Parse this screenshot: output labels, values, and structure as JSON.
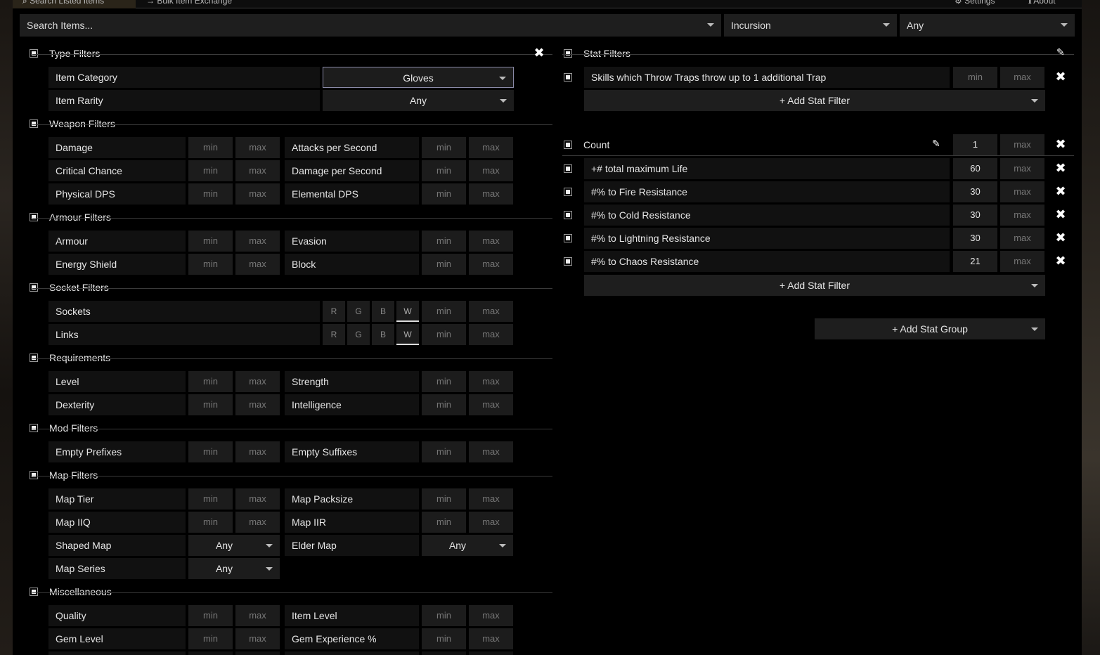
{
  "tabs": {
    "search": "Search Listed Items",
    "bulk": "Bulk Item Exchange",
    "settings": "Settings",
    "about": "About"
  },
  "search": {
    "placeholder": "Search Items...",
    "league": "Incursion",
    "status": "Any"
  },
  "type_filters": {
    "title": "Type Filters",
    "category_label": "Item Category",
    "category_value": "Gloves",
    "rarity_label": "Item Rarity",
    "rarity_value": "Any"
  },
  "weapon_filters": {
    "title": "Weapon Filters",
    "rows": [
      [
        "Damage",
        "Attacks per Second"
      ],
      [
        "Critical Chance",
        "Damage per Second"
      ],
      [
        "Physical DPS",
        "Elemental DPS"
      ]
    ]
  },
  "armour_filters": {
    "title": "Armour Filters",
    "rows": [
      [
        "Armour",
        "Evasion"
      ],
      [
        "Energy Shield",
        "Block"
      ]
    ]
  },
  "socket_filters": {
    "title": "Socket Filters",
    "sockets": "Sockets",
    "links": "Links",
    "colors": [
      "R",
      "G",
      "B",
      "W"
    ]
  },
  "requirements": {
    "title": "Requirements",
    "rows": [
      [
        "Level",
        "Strength"
      ],
      [
        "Dexterity",
        "Intelligence"
      ]
    ]
  },
  "mod_filters": {
    "title": "Mod Filters",
    "rows": [
      [
        "Empty Prefixes",
        "Empty Suffixes"
      ]
    ]
  },
  "map_filters": {
    "title": "Map Filters",
    "rows": [
      [
        "Map Tier",
        "Map Packsize"
      ],
      [
        "Map IIQ",
        "Map IIR"
      ]
    ],
    "shaped": "Shaped Map",
    "elder": "Elder Map",
    "series": "Map Series",
    "any": "Any"
  },
  "misc": {
    "title": "Miscellaneous",
    "rows": [
      [
        "Quality",
        "Item Level"
      ],
      [
        "Gem Level",
        "Gem Experience %"
      ]
    ]
  },
  "placeholders": {
    "min": "min",
    "max": "max"
  },
  "stat_filters": {
    "title": "Stat Filters",
    "stat1": "Skills which Throw Traps throw up to 1 additional Trap",
    "add_stat": "+ Add Stat Filter"
  },
  "count_group": {
    "title": "Count",
    "min": "1",
    "stats": [
      {
        "label": "+# total maximum Life",
        "min": "60"
      },
      {
        "label": "#% to Fire Resistance",
        "min": "30"
      },
      {
        "label": "#% to Cold Resistance",
        "min": "30"
      },
      {
        "label": "#% to Lightning Resistance",
        "min": "30"
      },
      {
        "label": "#% to Chaos Resistance",
        "min": "21"
      }
    ],
    "add_stat": "+ Add Stat Filter"
  },
  "add_group": "+ Add Stat Group"
}
